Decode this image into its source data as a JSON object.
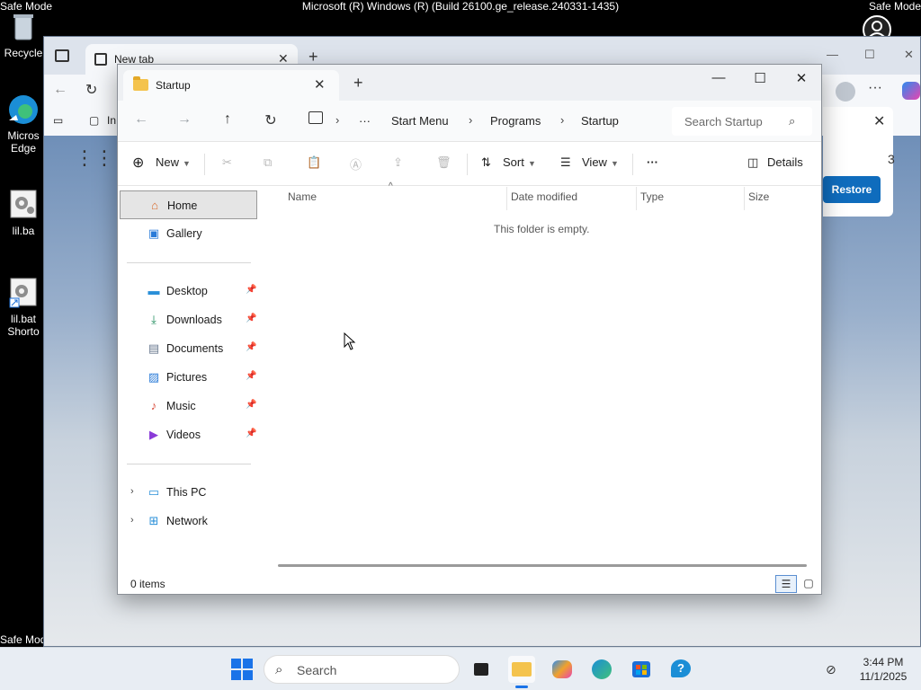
{
  "desktop": {
    "safe_mode_label": "Safe Mode",
    "safe_mode_bottom_label": "Safe Mod",
    "build_title": "Microsoft (R) Windows (R) (Build 26100.ge_release.240331-1435)",
    "icons": [
      {
        "label": "Recycle"
      },
      {
        "label": "Micros"
      },
      {
        "label": "Edge"
      },
      {
        "label": "lil.ba"
      },
      {
        "label": "lil.bat"
      },
      {
        "label": "Shorto"
      }
    ]
  },
  "browser": {
    "tab_title": "New tab",
    "toolbar_partial": "In",
    "restore_button": "Restore",
    "restore_partial": "3"
  },
  "explorer": {
    "tab_title": "Startup",
    "breadcrumbs": [
      "Start Menu",
      "Programs",
      "Startup"
    ],
    "search_placeholder": "Search Startup",
    "commands": {
      "new": "New",
      "sort": "Sort",
      "view": "View",
      "more": "···",
      "details": "Details"
    },
    "nav": {
      "home": "Home",
      "gallery": "Gallery",
      "pinned": [
        {
          "label": "Desktop",
          "icon": "desktop-icon"
        },
        {
          "label": "Downloads",
          "icon": "download-icon"
        },
        {
          "label": "Documents",
          "icon": "document-icon"
        },
        {
          "label": "Pictures",
          "icon": "pictures-icon"
        },
        {
          "label": "Music",
          "icon": "music-icon"
        },
        {
          "label": "Videos",
          "icon": "video-icon"
        }
      ],
      "this_pc": "This PC",
      "network": "Network"
    },
    "columns": [
      "Name",
      "Date modified",
      "Type",
      "Size"
    ],
    "empty_message": "This folder is empty.",
    "status": "0 items"
  },
  "taskbar": {
    "search_placeholder": "Search",
    "time": "3:44 PM",
    "date": "11/1/2025"
  },
  "colors": {
    "accent": "#0f6cbd",
    "folder": "#f4c34d"
  }
}
